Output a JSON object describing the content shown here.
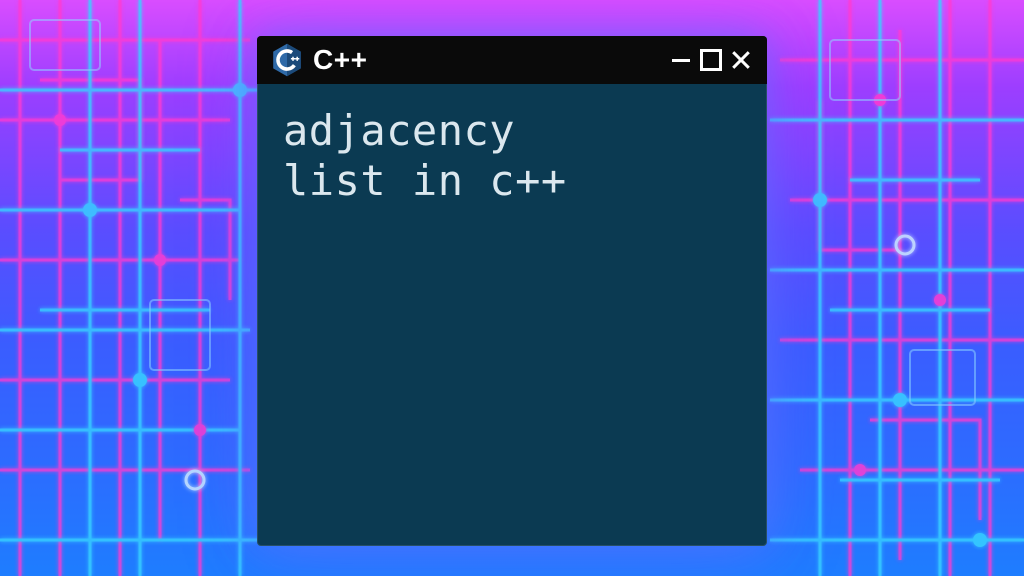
{
  "app": {
    "icon_name": "cpp-logo-icon",
    "title": "C++"
  },
  "window": {
    "content": "adjacency\nlist in c++"
  },
  "colors": {
    "window_bg": "#0b3a52",
    "titlebar_bg": "#0a0a0a",
    "text": "#dbe7ee"
  }
}
